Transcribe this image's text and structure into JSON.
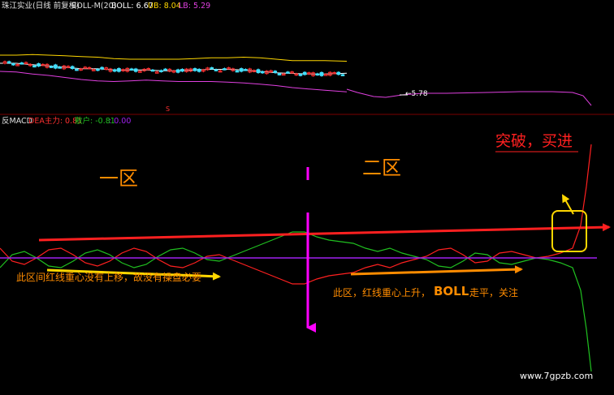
{
  "upper_panel": {
    "name": "珠江实业(日线 前复权)",
    "indicator": "BOLL-M(20)",
    "boll_label": "BOLL: 6.67",
    "ub_label": "UB: 8.04",
    "lb_label": "LB: 5.29",
    "min_marker": "←5.78",
    "marker_s": "S",
    "colors": {
      "boll": "#ffffff",
      "ub": "#ffd700",
      "lb": "#e040e0",
      "candle_up": "#ff3030",
      "candle_down": "#40e0ff"
    }
  },
  "lower_panel": {
    "indicator_name": "反MACD",
    "dea_label": "DEA主力: 0.81",
    "retail_label": "散户: -0.81",
    "zero_label": ": 0.00",
    "colors": {
      "main_force": "#ff2020",
      "retail": "#20c020",
      "zero_line": "#a020f0"
    }
  },
  "annotations": {
    "zone1": "一区",
    "zone2": "二区",
    "breakout": "突破，买进",
    "note1": "此区间红线重心没有上移，故没有操盘必要",
    "note2_prefix": "此区，红线重心上升，",
    "note2_boll": "BOLL",
    "note2_suffix": "走平，关注",
    "watermark": "www.7gpzb.com"
  },
  "chart_data": [
    {
      "type": "line",
      "x": [
        0,
        20,
        40,
        60,
        80,
        100,
        120,
        140,
        160,
        180,
        200,
        220,
        240,
        260,
        280,
        300,
        320,
        340,
        360,
        380,
        400,
        427
      ],
      "series": [
        {
          "name": "UB",
          "values": [
            8.0,
            8.0,
            8.04,
            8.0,
            7.95,
            7.9,
            7.85,
            7.75,
            7.7,
            7.7,
            7.7,
            7.7,
            7.75,
            7.8,
            7.8,
            7.85,
            7.8,
            7.7,
            7.6,
            7.6,
            7.6,
            7.55
          ]
        },
        {
          "name": "BOLL",
          "values": [
            7.4,
            7.4,
            7.3,
            7.2,
            7.1,
            7.0,
            7.0,
            6.9,
            6.9,
            6.9,
            6.85,
            6.85,
            6.9,
            6.95,
            6.95,
            6.9,
            6.8,
            6.7,
            6.65,
            6.6,
            6.6,
            6.67
          ]
        },
        {
          "name": "LB",
          "values": [
            6.8,
            6.75,
            6.6,
            6.5,
            6.35,
            6.2,
            6.1,
            6.05,
            6.1,
            6.15,
            6.1,
            6.05,
            6.05,
            6.05,
            6.0,
            5.95,
            5.85,
            5.75,
            5.6,
            5.5,
            5.4,
            5.29
          ]
        }
      ]
    },
    {
      "type": "line",
      "x": [
        0,
        15,
        30,
        45,
        60,
        75,
        90,
        105,
        120,
        135,
        150,
        165,
        180,
        195,
        210,
        225,
        240,
        255,
        270,
        285,
        300,
        315,
        330,
        345,
        360,
        375,
        390,
        405,
        420,
        435,
        450,
        465,
        480,
        495,
        510,
        525,
        540,
        555,
        570,
        585,
        600,
        615,
        630,
        645,
        660,
        675,
        690,
        705,
        715,
        722,
        728
      ],
      "series": [
        {
          "name": "DEA主力",
          "values": [
            0.3,
            -0.1,
            -0.2,
            0.0,
            0.25,
            0.3,
            0.1,
            -0.15,
            -0.25,
            -0.1,
            0.15,
            0.3,
            0.2,
            -0.05,
            -0.25,
            -0.3,
            -0.15,
            0.05,
            0.1,
            -0.05,
            -0.2,
            -0.35,
            -0.5,
            -0.65,
            -0.8,
            -0.8,
            -0.65,
            -0.55,
            -0.5,
            -0.45,
            -0.3,
            -0.2,
            -0.3,
            -0.15,
            -0.05,
            0.05,
            0.25,
            0.3,
            0.1,
            -0.15,
            -0.1,
            0.15,
            0.2,
            0.1,
            0.0,
            0.05,
            0.15,
            0.3,
            1.0,
            2.2,
            3.5
          ]
        },
        {
          "name": "散户",
          "values": [
            -0.3,
            0.1,
            0.2,
            0.0,
            -0.25,
            -0.3,
            -0.1,
            0.15,
            0.25,
            0.1,
            -0.15,
            -0.3,
            -0.2,
            0.05,
            0.25,
            0.3,
            0.15,
            -0.05,
            -0.1,
            0.05,
            0.2,
            0.35,
            0.5,
            0.65,
            0.8,
            0.8,
            0.65,
            0.55,
            0.5,
            0.45,
            0.3,
            0.2,
            0.3,
            0.15,
            0.05,
            -0.05,
            -0.25,
            -0.3,
            -0.1,
            0.15,
            0.1,
            -0.15,
            -0.2,
            -0.1,
            0.0,
            -0.05,
            -0.15,
            -0.3,
            -1.0,
            -2.2,
            -3.5
          ]
        },
        {
          "name": "zero",
          "values": [
            0,
            0,
            0,
            0,
            0,
            0,
            0,
            0,
            0,
            0,
            0,
            0,
            0,
            0,
            0,
            0,
            0,
            0,
            0,
            0,
            0,
            0,
            0,
            0,
            0,
            0,
            0,
            0,
            0,
            0,
            0,
            0,
            0,
            0,
            0,
            0,
            0,
            0,
            0,
            0,
            0,
            0,
            0,
            0,
            0,
            0,
            0,
            0,
            0,
            0,
            0
          ]
        }
      ]
    }
  ]
}
